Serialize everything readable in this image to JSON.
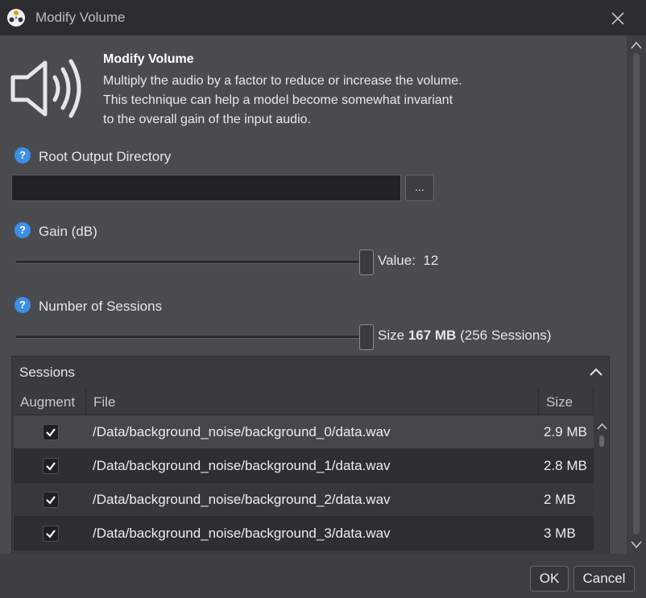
{
  "window": {
    "title": "Modify Volume",
    "logo_icon": "app-logo-icon",
    "close_icon": "close-icon"
  },
  "header": {
    "icon": "speaker-volume-icon",
    "title": "Modify Volume",
    "description_lines": [
      "Multiply the audio by a factor to reduce or increase the volume.",
      "This technique can help a model become somewhat invariant",
      "to the overall gain of the input audio."
    ]
  },
  "fields": {
    "root_output": {
      "label": "Root Output Directory",
      "value": "",
      "placeholder": "",
      "browse_label": "..."
    },
    "gain": {
      "label": "Gain (dB)",
      "value_prefix": "Value:",
      "value": "12",
      "slider_fraction": 1.0
    },
    "sessions_count": {
      "label": "Number of Sessions",
      "size_prefix": "Size",
      "size_value": "167 MB",
      "sessions_text": "(256 Sessions)",
      "slider_fraction": 1.0
    }
  },
  "sessions": {
    "title": "Sessions",
    "collapse_icon": "chevron-up-icon",
    "columns": [
      "Augment",
      "File",
      "Size"
    ],
    "rows": [
      {
        "checked": true,
        "file": "/Data/background_noise/background_0/data.wav",
        "size": "2.9 MB"
      },
      {
        "checked": true,
        "file": "/Data/background_noise/background_1/data.wav",
        "size": "2.8 MB"
      },
      {
        "checked": true,
        "file": "/Data/background_noise/background_2/data.wav",
        "size": "2 MB"
      },
      {
        "checked": true,
        "file": "/Data/background_noise/background_3/data.wav",
        "size": "3 MB"
      }
    ]
  },
  "footer": {
    "ok_label": "OK",
    "cancel_label": "Cancel"
  },
  "colors": {
    "accent_help": "#3d8ee6",
    "background": "#4a4b4f",
    "titlebar": "#2c2d30"
  }
}
